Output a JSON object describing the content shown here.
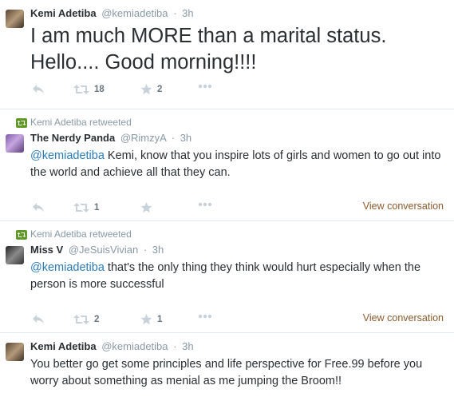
{
  "tweets": [
    {
      "author_name": "Kemi Adetiba",
      "handle": "@kemiadetiba",
      "dot": "·",
      "time": "3h",
      "text": "I am much MORE than a marital status. Hello.... Good morning!!!!",
      "retweets": "18",
      "favorites": "2"
    },
    {
      "retweeted_by": "Kemi Adetiba retweeted",
      "author_name": "The Nerdy Panda",
      "handle": "@RimzyA",
      "dot": "·",
      "time": "3h",
      "mention": "@kemiadetiba",
      "text": " Kemi, know that you inspire lots of girls and women to go out into the world and achieve all that they can.",
      "retweets": "1",
      "view_conversation": "View conversation"
    },
    {
      "retweeted_by": "Kemi Adetiba retweeted",
      "author_name": "Miss V",
      "handle": "@JeSuisVivian",
      "dot": "·",
      "time": "3h",
      "mention": "@kemiadetiba",
      "text": " that's the only thing they think would hurt especially when the person is more successful",
      "retweets": "2",
      "favorites": "1",
      "view_conversation": "View conversation"
    },
    {
      "author_name": "Kemi Adetiba",
      "handle": "@kemiadetiba",
      "dot": "·",
      "time": "3h",
      "text": "You better go get some principles and life perspective for Free.99 before you worry about something as menial as me jumping the Broom!!"
    }
  ],
  "colors": {
    "text": "#292f33",
    "muted": "#8899a6",
    "mention": "#2b7bb9",
    "icon": "#c8d2da",
    "retweet_green": "#609928",
    "view_conversation": "#8b5a2b"
  },
  "icons": [
    "reply-icon",
    "retweet-icon",
    "favorite-icon",
    "more-icon",
    "retweeted-icon"
  ]
}
